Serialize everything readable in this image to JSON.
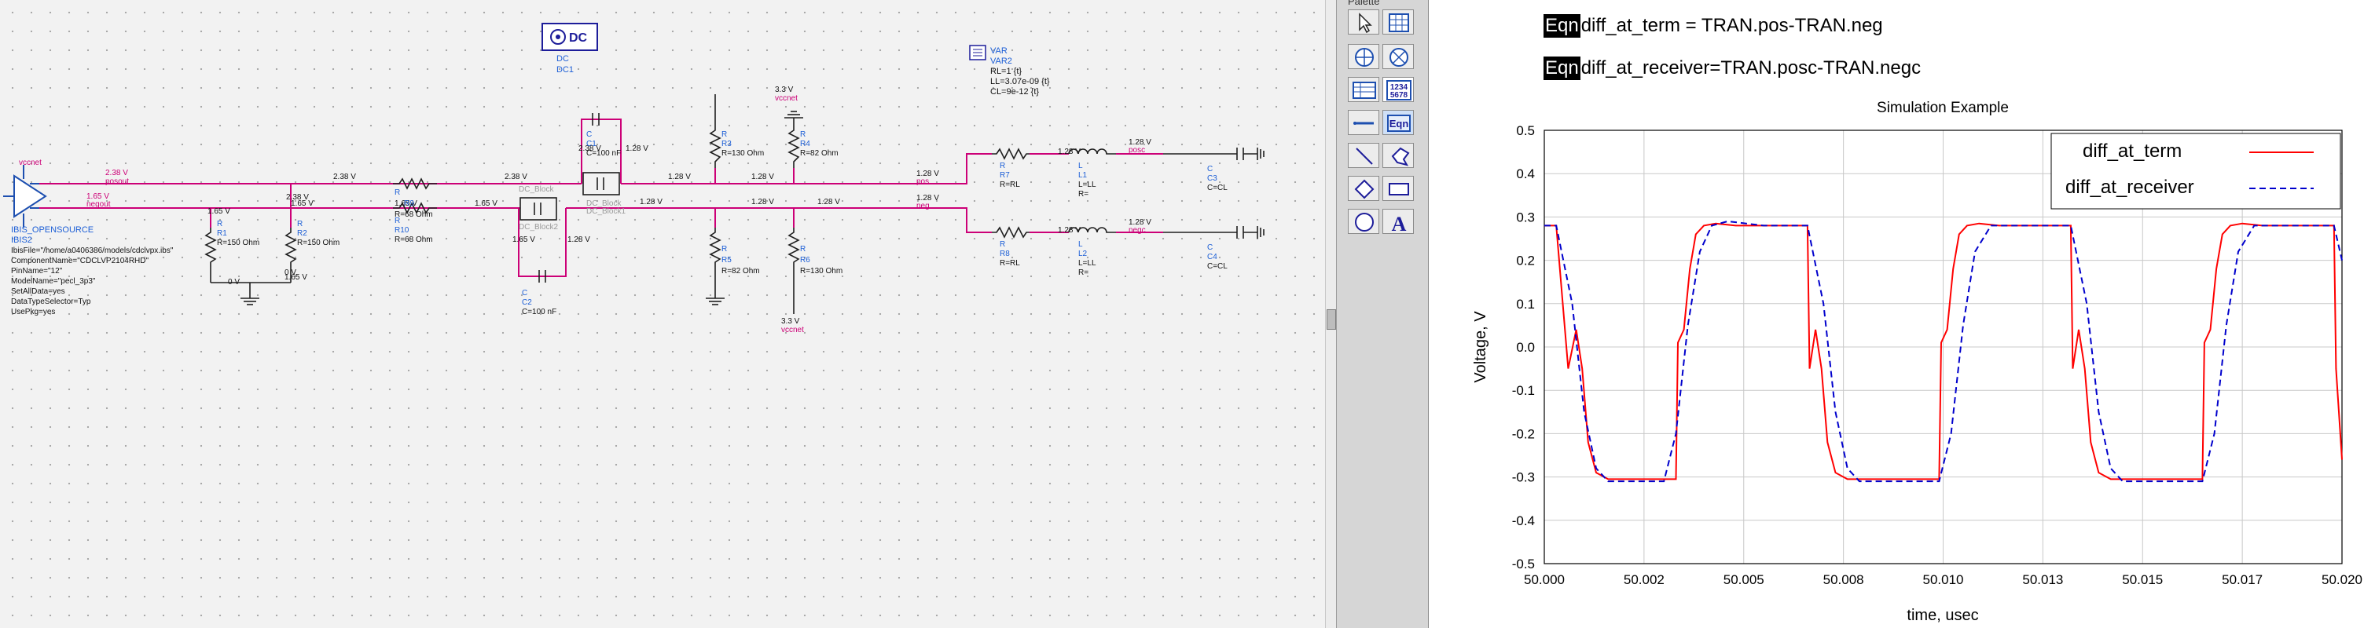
{
  "schematic": {
    "labels": {
      "dc_badge": "DC",
      "dc_type": "DC",
      "dc_name": "DC1",
      "var_badge": "VAR",
      "var_name": "VAR2",
      "var_rl": "RL=1 {t}",
      "var_ll": "LL=3.07e-09 {t}",
      "var_cl": "CL=9e-12 {t}",
      "vccnet_top": "vccnet",
      "v33_top": "3.3 V",
      "v33_bottom": "3.3 V",
      "vccnet_bottom": "vccnet",
      "posout": "posout",
      "negout": "negout",
      "v238_a": "2.38 V",
      "v238_b": "2.38 V",
      "v238_c": "2.38 V",
      "v238_d": "2.38 V",
      "v238_e": "2.38 V",
      "v165_a": "1.65 V",
      "v165_b": "1.65 V",
      "v165_c": "1.65 V",
      "v165_d": "1.65 V",
      "v165_e": "1.65 V",
      "v165_f": "1.65 V",
      "v165_g": "1.65 V",
      "v128_a": "1.28 V",
      "v128_b": "1.28 V",
      "v128_c": "1.28 V",
      "v128_d": "1.28 V",
      "v128_e": "1.28 V",
      "v128_f": "1.28 V",
      "v128_g": "1.28 V",
      "v128_h": "1.28 V",
      "v128_i": "1.28 V",
      "v128_j": "1.28 V",
      "v128_k": "1.28 V",
      "v128_l": "1.28 V",
      "v128_m": "1.28 V",
      "v0_a": "0 V",
      "v0_b": "0 V",
      "pos": "pos",
      "neg": "neg",
      "posc": "posc",
      "negc": "negc",
      "r1_type": "R",
      "r1_name": "R1",
      "r1_val": "R=150 Ohm",
      "r2_type": "R",
      "r2_name": "R2",
      "r2_val": "R=150 Ohm",
      "r9_type": "R",
      "r9_name": "R9",
      "r9_val": "R=68 Ohm",
      "r10_type": "R",
      "r10_name": "R10",
      "r10_val": "R=68 Ohm",
      "r3_type": "R",
      "r3_name": "R3",
      "r3_val": "R=130 Ohm",
      "r4_type": "R",
      "r4_name": "R4",
      "r4_val": "R=82 Ohm",
      "r5_type": "R",
      "r5_name": "R5",
      "r5_val": "R=82 Ohm",
      "r6_type": "R",
      "r6_name": "R6",
      "r6_val": "R=130 Ohm",
      "r7_type": "R",
      "r7_name": "R7",
      "r7_val": "R=RL",
      "r8_type": "R",
      "r8_name": "R8",
      "r8_val": "R=RL",
      "l1_type": "L",
      "l1_name": "L1",
      "l1_val": "L=LL",
      "l1_r": "R=",
      "l2_type": "L",
      "l2_name": "L2",
      "l2_val": "L=LL",
      "l2_r": "R=",
      "c1_type": "C",
      "c1_name": "C1",
      "c1_val": "C=100 nF",
      "c2_type": "C",
      "c2_name": "C2",
      "c2_val": "C=100 nF",
      "c3_type": "C",
      "c3_name": "C3",
      "c3_val": "C=CL",
      "c4_type": "C",
      "c4_name": "C4",
      "c4_val": "C=CL",
      "dcblock1": "DC_Block",
      "dcblock1b": "DC_Block1",
      "dcblock2": "DC_Block",
      "dcblock2b": "DC_Block2",
      "ibis_title": "IBIS_OPENSOURCE",
      "ibis_name": "IBIS2",
      "ibis_file": "IbisFile=\"/home/a0406386/models/cdclvpx.ibs\"",
      "ibis_comp": "ComponentName=\"CDCLVP2104RHD\"",
      "ibis_pin": "PinName=\"12\"",
      "ibis_model": "ModelName=\"pecl_3p3\"",
      "ibis_set": "SetAllData=yes",
      "ibis_dts": "DataTypeSelector=Typ",
      "ibis_pkg": "UsePkg=yes"
    }
  },
  "palette": {
    "title": "Palette",
    "buttons": {
      "select": "pointer-icon",
      "grid": "grid-icon",
      "target": "target-icon",
      "compass": "compass-icon",
      "list": "list-table-icon",
      "numbers": [
        "1234",
        "5678"
      ],
      "eqn": "Eqn",
      "line": "line-icon",
      "polygon": "polygon-icon",
      "diamond": "diamond-icon",
      "rectangle": "rectangle-icon",
      "circle": "circle-icon",
      "text": "A"
    }
  },
  "equations": {
    "tag": "Eqn",
    "eq1": "diff_at_term = TRAN.pos-TRAN.neg",
    "eq2": "diff_at_receiver=TRAN.posc-TRAN.negc"
  },
  "colors": {
    "wire": "#cc0077",
    "component": "#1f1f1f",
    "label": "#1d5fd6",
    "term": "#ff0000",
    "receiver": "#0000cc"
  },
  "chart_data": {
    "type": "line",
    "title": "Simulation Example",
    "xlabel": "time, usec",
    "ylabel": "Voltage, V",
    "xlim": [
      50.0,
      50.02
    ],
    "ylim": [
      -0.5,
      0.5
    ],
    "xticks": [
      "50.000",
      "50.002",
      "50.005",
      "50.008",
      "50.010",
      "50.013",
      "50.015",
      "50.017",
      "50.020"
    ],
    "yticks": [
      "0.5",
      "0.4",
      "0.3",
      "0.2",
      "0.1",
      "0.0",
      "-0.1",
      "-0.2",
      "-0.3",
      "-0.4",
      "-0.5"
    ],
    "grid": true,
    "legend": "top-right",
    "series": [
      {
        "name": "diff_at_term",
        "color": "#ff0000",
        "style": "solid",
        "x": [
          50.0,
          50.0003,
          50.0006,
          50.0008,
          50.00095,
          50.0011,
          50.0013,
          50.0016,
          50.0019,
          50.0022,
          50.0025,
          50.003,
          50.0033,
          50.00335,
          50.0035,
          50.00365,
          50.0038,
          50.004,
          50.0043,
          50.0048,
          50.0055,
          50.0066,
          50.00665,
          50.0068,
          50.00695,
          50.0071,
          50.0073,
          50.0076,
          50.008,
          50.0085,
          50.0092,
          50.0099,
          50.00995,
          50.0101,
          50.01025,
          50.0104,
          50.0106,
          50.0109,
          50.0114,
          50.0121,
          50.0132,
          50.01325,
          50.0134,
          50.01355,
          50.0137,
          50.0139,
          50.0142,
          50.0146,
          50.0151,
          50.0158,
          50.0165,
          50.01655,
          50.0167,
          50.01685,
          50.017,
          50.0172,
          50.0175,
          50.018,
          50.0187,
          50.0198,
          50.01985,
          50.02
        ],
        "y": [
          0.28,
          0.28,
          -0.05,
          0.04,
          -0.05,
          -0.22,
          -0.29,
          -0.305,
          -0.305,
          -0.305,
          -0.305,
          -0.305,
          -0.305,
          0.01,
          0.04,
          0.18,
          0.26,
          0.28,
          0.285,
          0.28,
          0.28,
          0.28,
          -0.05,
          0.04,
          -0.05,
          -0.22,
          -0.29,
          -0.305,
          -0.305,
          -0.305,
          -0.305,
          -0.305,
          0.01,
          0.04,
          0.18,
          0.26,
          0.28,
          0.285,
          0.28,
          0.28,
          0.28,
          -0.05,
          0.04,
          -0.05,
          -0.22,
          -0.29,
          -0.305,
          -0.305,
          -0.305,
          -0.305,
          -0.305,
          0.01,
          0.04,
          0.18,
          0.26,
          0.28,
          0.285,
          0.28,
          0.28,
          0.28,
          -0.05,
          -0.26
        ]
      },
      {
        "name": "diff_at_receiver",
        "color": "#0000cc",
        "style": "dashed",
        "x": [
          50.0,
          50.0003,
          50.0007,
          50.001,
          50.0013,
          50.0016,
          50.002,
          50.0025,
          50.003,
          50.0033,
          50.0036,
          50.0039,
          50.0042,
          50.0046,
          50.0055,
          50.0066,
          50.007,
          50.0073,
          50.0076,
          50.0079,
          50.0083,
          50.009,
          50.0099,
          50.0102,
          50.0105,
          50.0108,
          50.0112,
          50.012,
          50.0132,
          50.0136,
          50.0139,
          50.0142,
          50.0145,
          50.0149,
          50.0156,
          50.0165,
          50.0168,
          50.0171,
          50.0174,
          50.0178,
          50.0186,
          50.0198,
          50.02
        ],
        "y": [
          0.28,
          0.28,
          0.1,
          -0.15,
          -0.28,
          -0.31,
          -0.31,
          -0.31,
          -0.31,
          -0.2,
          0.05,
          0.22,
          0.28,
          0.29,
          0.28,
          0.28,
          0.1,
          -0.15,
          -0.28,
          -0.31,
          -0.31,
          -0.31,
          -0.31,
          -0.2,
          0.05,
          0.22,
          0.28,
          0.28,
          0.28,
          0.1,
          -0.15,
          -0.28,
          -0.31,
          -0.31,
          -0.31,
          -0.31,
          -0.2,
          0.05,
          0.22,
          0.28,
          0.28,
          0.28,
          0.2
        ]
      }
    ]
  }
}
